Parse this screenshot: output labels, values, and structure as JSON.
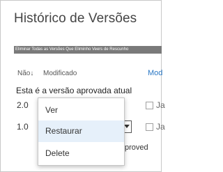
{
  "dialog": {
    "title": "Histórico de Versões",
    "actions_label": "Eliminar Todas as Versões Que Eliminho Veers de Rescunho"
  },
  "table": {
    "col_number": "Não",
    "col_number_sort_icon": "arrow-down-icon",
    "col_modified": "Modificado",
    "col_right_partial": "Mod",
    "approved_note": "Esta é a versão aprovada atual",
    "rows": [
      {
        "version": "2.0",
        "partial_text": "Ja"
      },
      {
        "version": "1.0",
        "partial_text": "Ja",
        "trailing_text": "proved"
      }
    ]
  },
  "context_menu": {
    "items": [
      {
        "label": "Ver"
      },
      {
        "label": "Restaurar"
      },
      {
        "label": "Delete"
      }
    ]
  },
  "colors": {
    "accent": "#2b78c5",
    "action_bar": "#7a7a7a",
    "menu_highlight": "#e6f0fa"
  }
}
